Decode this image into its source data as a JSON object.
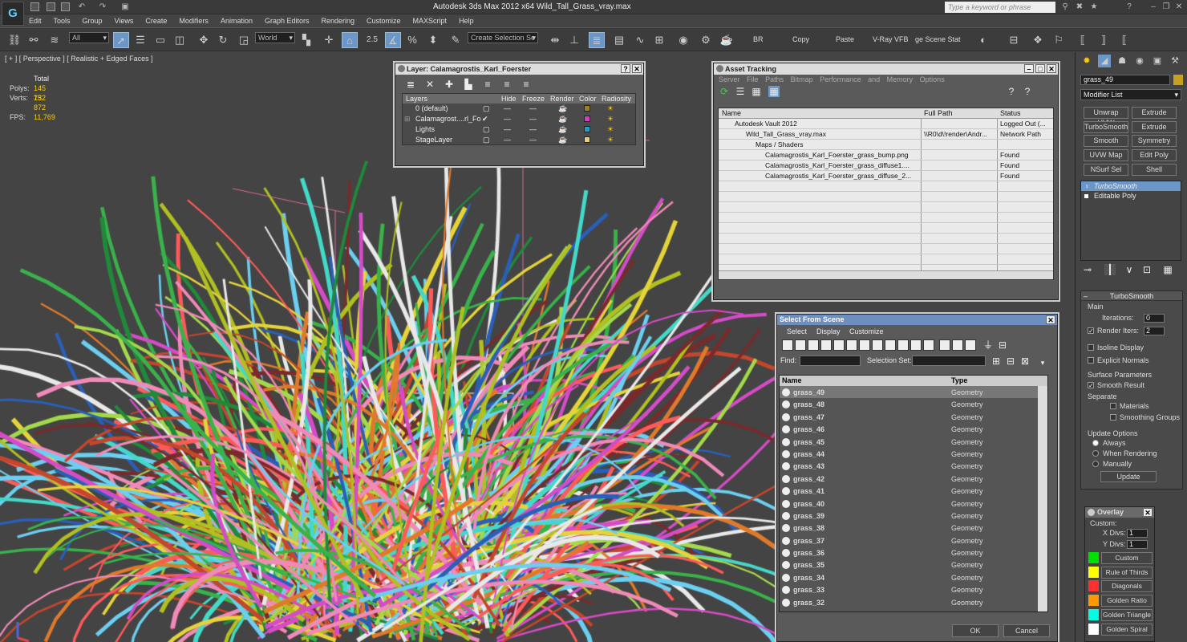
{
  "app": {
    "window_title": "Autodesk 3ds Max  2012 x64      Wild_Tall_Grass_vray.max",
    "search_placeholder": "Type a keyword or phrase"
  },
  "menu": [
    "Edit",
    "Tools",
    "Group",
    "Views",
    "Create",
    "Modifiers",
    "Animation",
    "Graph Editors",
    "Rendering",
    "Customize",
    "MAXScript",
    "Help"
  ],
  "toolbar": {
    "filter": "All",
    "coord_system": "World",
    "snap_angle": "2.5",
    "named_selection": "Create Selection Se",
    "br": "BR",
    "copy": "Copy",
    "paste": "Paste",
    "vray_vfb": "V-Ray VFB",
    "scene_states": "ge Scene Stat"
  },
  "viewport": {
    "label": "[ + ] [ Perspective ] [ Realistic + Edged Faces ]",
    "stats": {
      "total_label": "Total",
      "polys_label": "Polys:",
      "polys": "145 152",
      "verts_label": "Verts:",
      "verts": "73 872",
      "fps_label": "FPS:",
      "fps": "11,769"
    }
  },
  "layer_panel": {
    "title": "Layer: Calamagrostis_Karl_Foerster",
    "columns": [
      "Layers",
      "Hide",
      "Freeze",
      "Render",
      "Color",
      "Radiosity"
    ],
    "rows": [
      {
        "name": "0 (default)",
        "color": "#a08020"
      },
      {
        "name": "Calamagrost....rl_Fo",
        "color": "#d040c0"
      },
      {
        "name": "Lights",
        "color": "#20a0c0"
      },
      {
        "name": "StageLayer",
        "color": "#e0d080"
      }
    ]
  },
  "asset_panel": {
    "title": "Asset Tracking",
    "menu": [
      "Server",
      "File",
      "Paths",
      "Bitmap Performance and Memory",
      "Options"
    ],
    "columns": [
      "Name",
      "Full Path",
      "Status"
    ],
    "rows": [
      {
        "name": "Autodesk Vault 2012",
        "path": "",
        "status": "Logged Out (..."
      },
      {
        "name": "Wild_Tall_Grass_vray.max",
        "path": "\\\\R0\\d\\!render\\Andr...",
        "status": "Network Path"
      },
      {
        "name": "Maps / Shaders",
        "path": "",
        "status": ""
      },
      {
        "name": "Calamagrostis_Karl_Foerster_grass_bump.png",
        "path": "",
        "status": "Found"
      },
      {
        "name": "Calamagrostis_Karl_Foerster_grass_diffuse1....",
        "path": "",
        "status": "Found"
      },
      {
        "name": "Calamagrostis_Karl_Foerster_grass_diffuse_2...",
        "path": "",
        "status": "Found"
      }
    ]
  },
  "select_panel": {
    "title": "Select From Scene",
    "menu": [
      "Select",
      "Display",
      "Customize"
    ],
    "find_label": "Find:",
    "selection_set_label": "Selection Set:",
    "columns": [
      "Name",
      "Type"
    ],
    "rows": [
      {
        "name": "grass_49",
        "type": "Geometry"
      },
      {
        "name": "grass_48",
        "type": "Geometry"
      },
      {
        "name": "grass_47",
        "type": "Geometry"
      },
      {
        "name": "grass_46",
        "type": "Geometry"
      },
      {
        "name": "grass_45",
        "type": "Geometry"
      },
      {
        "name": "grass_44",
        "type": "Geometry"
      },
      {
        "name": "grass_43",
        "type": "Geometry"
      },
      {
        "name": "grass_42",
        "type": "Geometry"
      },
      {
        "name": "grass_41",
        "type": "Geometry"
      },
      {
        "name": "grass_40",
        "type": "Geometry"
      },
      {
        "name": "grass_39",
        "type": "Geometry"
      },
      {
        "name": "grass_38",
        "type": "Geometry"
      },
      {
        "name": "grass_37",
        "type": "Geometry"
      },
      {
        "name": "grass_36",
        "type": "Geometry"
      },
      {
        "name": "grass_35",
        "type": "Geometry"
      },
      {
        "name": "grass_34",
        "type": "Geometry"
      },
      {
        "name": "grass_33",
        "type": "Geometry"
      },
      {
        "name": "grass_32",
        "type": "Geometry"
      }
    ],
    "ok": "OK",
    "cancel": "Cancel"
  },
  "command_panel": {
    "object_name": "grass_49",
    "object_color": "#c8a020",
    "modifier_list": "Modifier List",
    "mod_buttons": [
      "Unwrap UVW",
      "Extrude",
      "TurboSmooth",
      "Extrude",
      "Smooth",
      "Symmetry",
      "UVW Map",
      "Edit Poly",
      "NSurf Sel",
      "Shell"
    ],
    "stack": [
      "TurboSmooth",
      "Editable Poly"
    ],
    "turbosmooth": {
      "title": "TurboSmooth",
      "main": "Main",
      "iterations_label": "Iterations:",
      "iterations": "0",
      "render_iters_label": "Render Iters:",
      "render_iters": "2",
      "isoline": "Isoline Display",
      "explicit": "Explicit Normals",
      "surface_params": "Surface Parameters",
      "smooth_result": "Smooth Result",
      "separate": "Separate",
      "materials": "Materials",
      "smoothing_groups": "Smoothing Groups",
      "update_options": "Update Options",
      "always": "Always",
      "when_rendering": "When Rendering",
      "manually": "Manually",
      "update": "Update"
    }
  },
  "overlay": {
    "title": "Overlay",
    "custom_label": "Custom:",
    "xdivs_label": "X Divs:",
    "xdivs": "1",
    "ydivs_label": "Y Divs:",
    "ydivs": "1",
    "items": [
      {
        "label": "Custom",
        "color": "#00e000"
      },
      {
        "label": "Rule of Thirds",
        "color": "#ffff00"
      },
      {
        "label": "Diagonals",
        "color": "#ff3030"
      },
      {
        "label": "Golden Ratio",
        "color": "#ff9900"
      },
      {
        "label": "Golden Triangle",
        "color": "#00ffe0"
      },
      {
        "label": "Golden Spiral",
        "color": "#ffffff"
      }
    ]
  }
}
